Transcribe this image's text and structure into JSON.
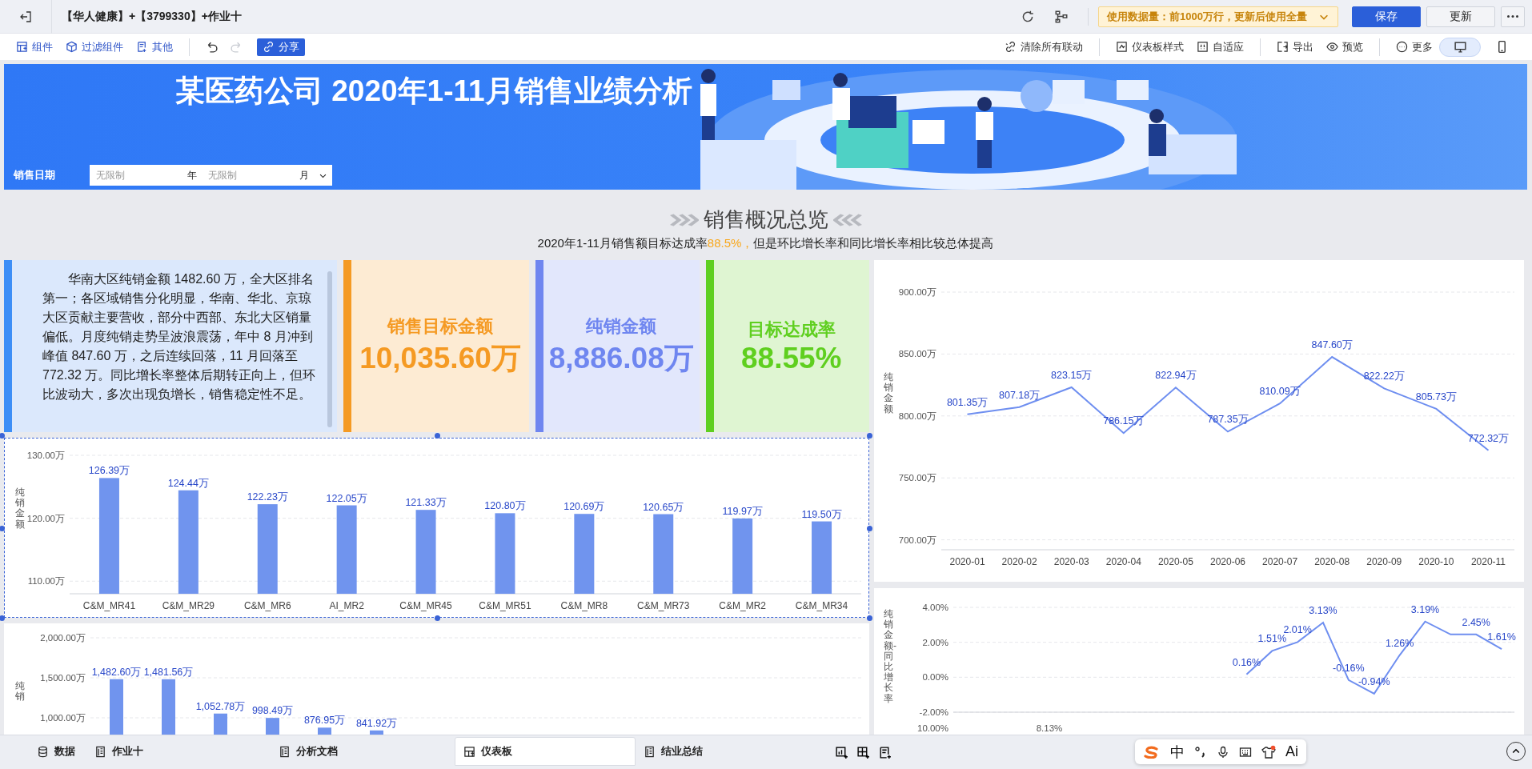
{
  "window": {
    "title": "【华人健康】+【3799330】+作业十"
  },
  "header": {
    "data_notice": "使用数据量：前1000万行，更新后使用全量",
    "buttons": [
      {
        "label": "保存",
        "kind": "primary"
      },
      {
        "label": "更新",
        "kind": "default"
      }
    ]
  },
  "toolbar": {
    "left": [
      {
        "kind": "component",
        "label": "组件"
      },
      {
        "kind": "filter",
        "label": "过滤组件"
      },
      {
        "kind": "other",
        "label": "其他"
      }
    ],
    "history": [
      {
        "kind": "undo",
        "disabled": false
      },
      {
        "kind": "redo",
        "disabled": true
      }
    ],
    "share": {
      "label": "分享"
    },
    "right": [
      {
        "kind": "unlink",
        "label": "清除所有联动"
      },
      {
        "kind": "style",
        "label": "仪表板样式"
      },
      {
        "kind": "fit",
        "label": "自适应"
      },
      {
        "kind": "export",
        "label": "导出"
      },
      {
        "kind": "preview",
        "label": "预览"
      },
      {
        "kind": "more",
        "label": "更多"
      }
    ],
    "view_modes": [
      {
        "kind": "desktop",
        "selected": true
      },
      {
        "kind": "mobile",
        "selected": false
      }
    ]
  },
  "banner": {
    "title": "某医药公司 2020年1-11月销售业绩分析",
    "filter": {
      "label": "销售日期",
      "fields": [
        {
          "placeholder": "无限制",
          "unit": "年"
        },
        {
          "placeholder": "无限制",
          "unit": "月"
        }
      ]
    }
  },
  "overview": {
    "title": "销售概况总览",
    "summary": {
      "before": "2020年1-11月销售额目标达成率",
      "highlight": "88.5%，",
      "after": "但是环比增长率和同比增长率相比较总体提高"
    }
  },
  "insight_text": "华南大区纯销金额 1482.60 万，全大区排名第一；各区域销售分化明显，华南、华北、京琼大区贡献主要营收，部分中西部、东北大区销量偏低。月度纯销走势呈波浪震荡，年中 8 月冲到峰值 847.60 万，之后连续回落，11 月回落至 772.32 万。同比增长率整体后期转正向上，但环比波动大，多次出现负增长，销售稳定性不足。",
  "kpis": [
    {
      "label": "销售目标金额",
      "value": "10,035.60万",
      "color": "#f59a23"
    },
    {
      "label": "纯销金额",
      "value": "8,886.08万",
      "color": "#6f86f0"
    },
    {
      "label": "目标达成率",
      "value": "88.55%",
      "color": "#5fcf1f"
    }
  ],
  "charts": [
    {
      "selected": true,
      "chart_data": {
        "type": "bar",
        "ylabel": "纯销金额",
        "grid": true,
        "categories": [
          "C&M_MR41",
          "C&M_MR29",
          "C&M_MR6",
          "AI_MR2",
          "C&M_MR45",
          "C&M_MR51",
          "C&M_MR8",
          "C&M_MR73",
          "C&M_MR2",
          "C&M_MR34"
        ],
        "series": [
          {
            "color": "#7094ee",
            "values": [
              126.39,
              124.44,
              122.23,
              122.05,
              121.33,
              120.8,
              120.69,
              120.65,
              119.97,
              119.5
            ]
          }
        ],
        "value_labels": [
          "126.39万",
          "124.44万",
          "122.23万",
          "122.05万",
          "121.33万",
          "120.80万",
          "120.69万",
          "120.65万",
          "119.97万",
          "119.50万"
        ],
        "ylim": [
          108,
          130
        ],
        "yticks": [
          {
            "value": 110,
            "label": "110.00万"
          },
          {
            "value": 120,
            "label": "120.00万"
          },
          {
            "value": 130,
            "label": "130.00万"
          }
        ]
      }
    },
    {
      "selected": false,
      "chart_data": {
        "type": "bar",
        "ylabel": "纯销",
        "grid": true,
        "series": [
          {
            "color": "#7094ee",
            "values": [
              1482.6,
              1481.56,
              1052.78,
              998.49,
              876.95,
              841.92
            ]
          }
        ],
        "value_labels": [
          "1,482.60万",
          "1,481.56万",
          "1,052.78万",
          "998.49万",
          "876.95万",
          "841.92万"
        ],
        "ylim": [
          0,
          2000
        ],
        "yticks": [
          {
            "value": 1000,
            "label": "1,000.00万"
          },
          {
            "value": 1500,
            "label": "1,500.00万"
          },
          {
            "value": 2000,
            "label": "2,000.00万"
          }
        ]
      }
    },
    {
      "selected": false,
      "chart_data": {
        "type": "line",
        "ylabel": "纯销金额",
        "grid": true,
        "categories": [
          "2020-01",
          "2020-02",
          "2020-03",
          "2020-04",
          "2020-05",
          "2020-06",
          "2020-07",
          "2020-08",
          "2020-09",
          "2020-10",
          "2020-11"
        ],
        "series": [
          {
            "color": "#6f8ff0",
            "values": [
              801.35,
              807.18,
              823.15,
              786.15,
              822.94,
              787.35,
              810.09,
              847.6,
              822.22,
              805.73,
              772.32
            ]
          }
        ],
        "value_labels": [
          "801.35万",
          "807.18万",
          "823.15万",
          "786.15万",
          "822.94万",
          "787.35万",
          "810.09万",
          "847.60万",
          "822.22万",
          "805.73万",
          "772.32万"
        ],
        "ylim": [
          692,
          900
        ],
        "yticks": [
          {
            "value": 700,
            "label": "700.00万"
          },
          {
            "value": 750,
            "label": "750.00万"
          },
          {
            "value": 800,
            "label": "800.00万"
          },
          {
            "value": 850,
            "label": "850.00万"
          },
          {
            "value": 900,
            "label": "900.00万"
          }
        ]
      }
    },
    {
      "selected": false,
      "chart_data": {
        "type": "line",
        "ylabel": "纯销金额-同比增长率",
        "grid": true,
        "series": [
          {
            "color": "#6f8ff0",
            "values": [
              null,
              null,
              null,
              null,
              null,
              null,
              null,
              null,
              null,
              null,
              null,
              0.16,
              1.51,
              2.01,
              3.13,
              -0.16,
              -0.94,
              1.26,
              3.19,
              2.45,
              2.45,
              1.61
            ]
          }
        ],
        "value_labels": [
          null,
          null,
          null,
          null,
          null,
          null,
          null,
          null,
          null,
          null,
          null,
          "0.16%",
          "1.51%",
          "2.01%",
          "3.13%",
          "-0.16%",
          "-0.94%",
          "1.26%",
          "3.19%",
          null,
          "2.45%",
          "1.61%"
        ],
        "ylim": [
          -2,
          4
        ],
        "yticks": [
          {
            "value": -2,
            "label": "-2.00%"
          },
          {
            "value": 0,
            "label": "0.00%"
          },
          {
            "value": 2,
            "label": "2.00%"
          },
          {
            "value": 4,
            "label": "4.00%"
          }
        ]
      },
      "next_chart_peek": {
        "tick": "10.00%",
        "label": "8.13%"
      }
    }
  ],
  "bottom_tabs": [
    {
      "kind": "data",
      "label": "数据",
      "selected": false
    },
    {
      "kind": "sheet",
      "label": "作业十",
      "selected": false
    },
    {
      "kind": "sheet",
      "label": "分析文档",
      "selected": false
    },
    {
      "kind": "dashboard",
      "label": "仪表板",
      "selected": true
    },
    {
      "kind": "sheet",
      "label": "结业总结",
      "selected": false
    }
  ],
  "ime": {
    "mode": "中",
    "ai": "Ai"
  }
}
